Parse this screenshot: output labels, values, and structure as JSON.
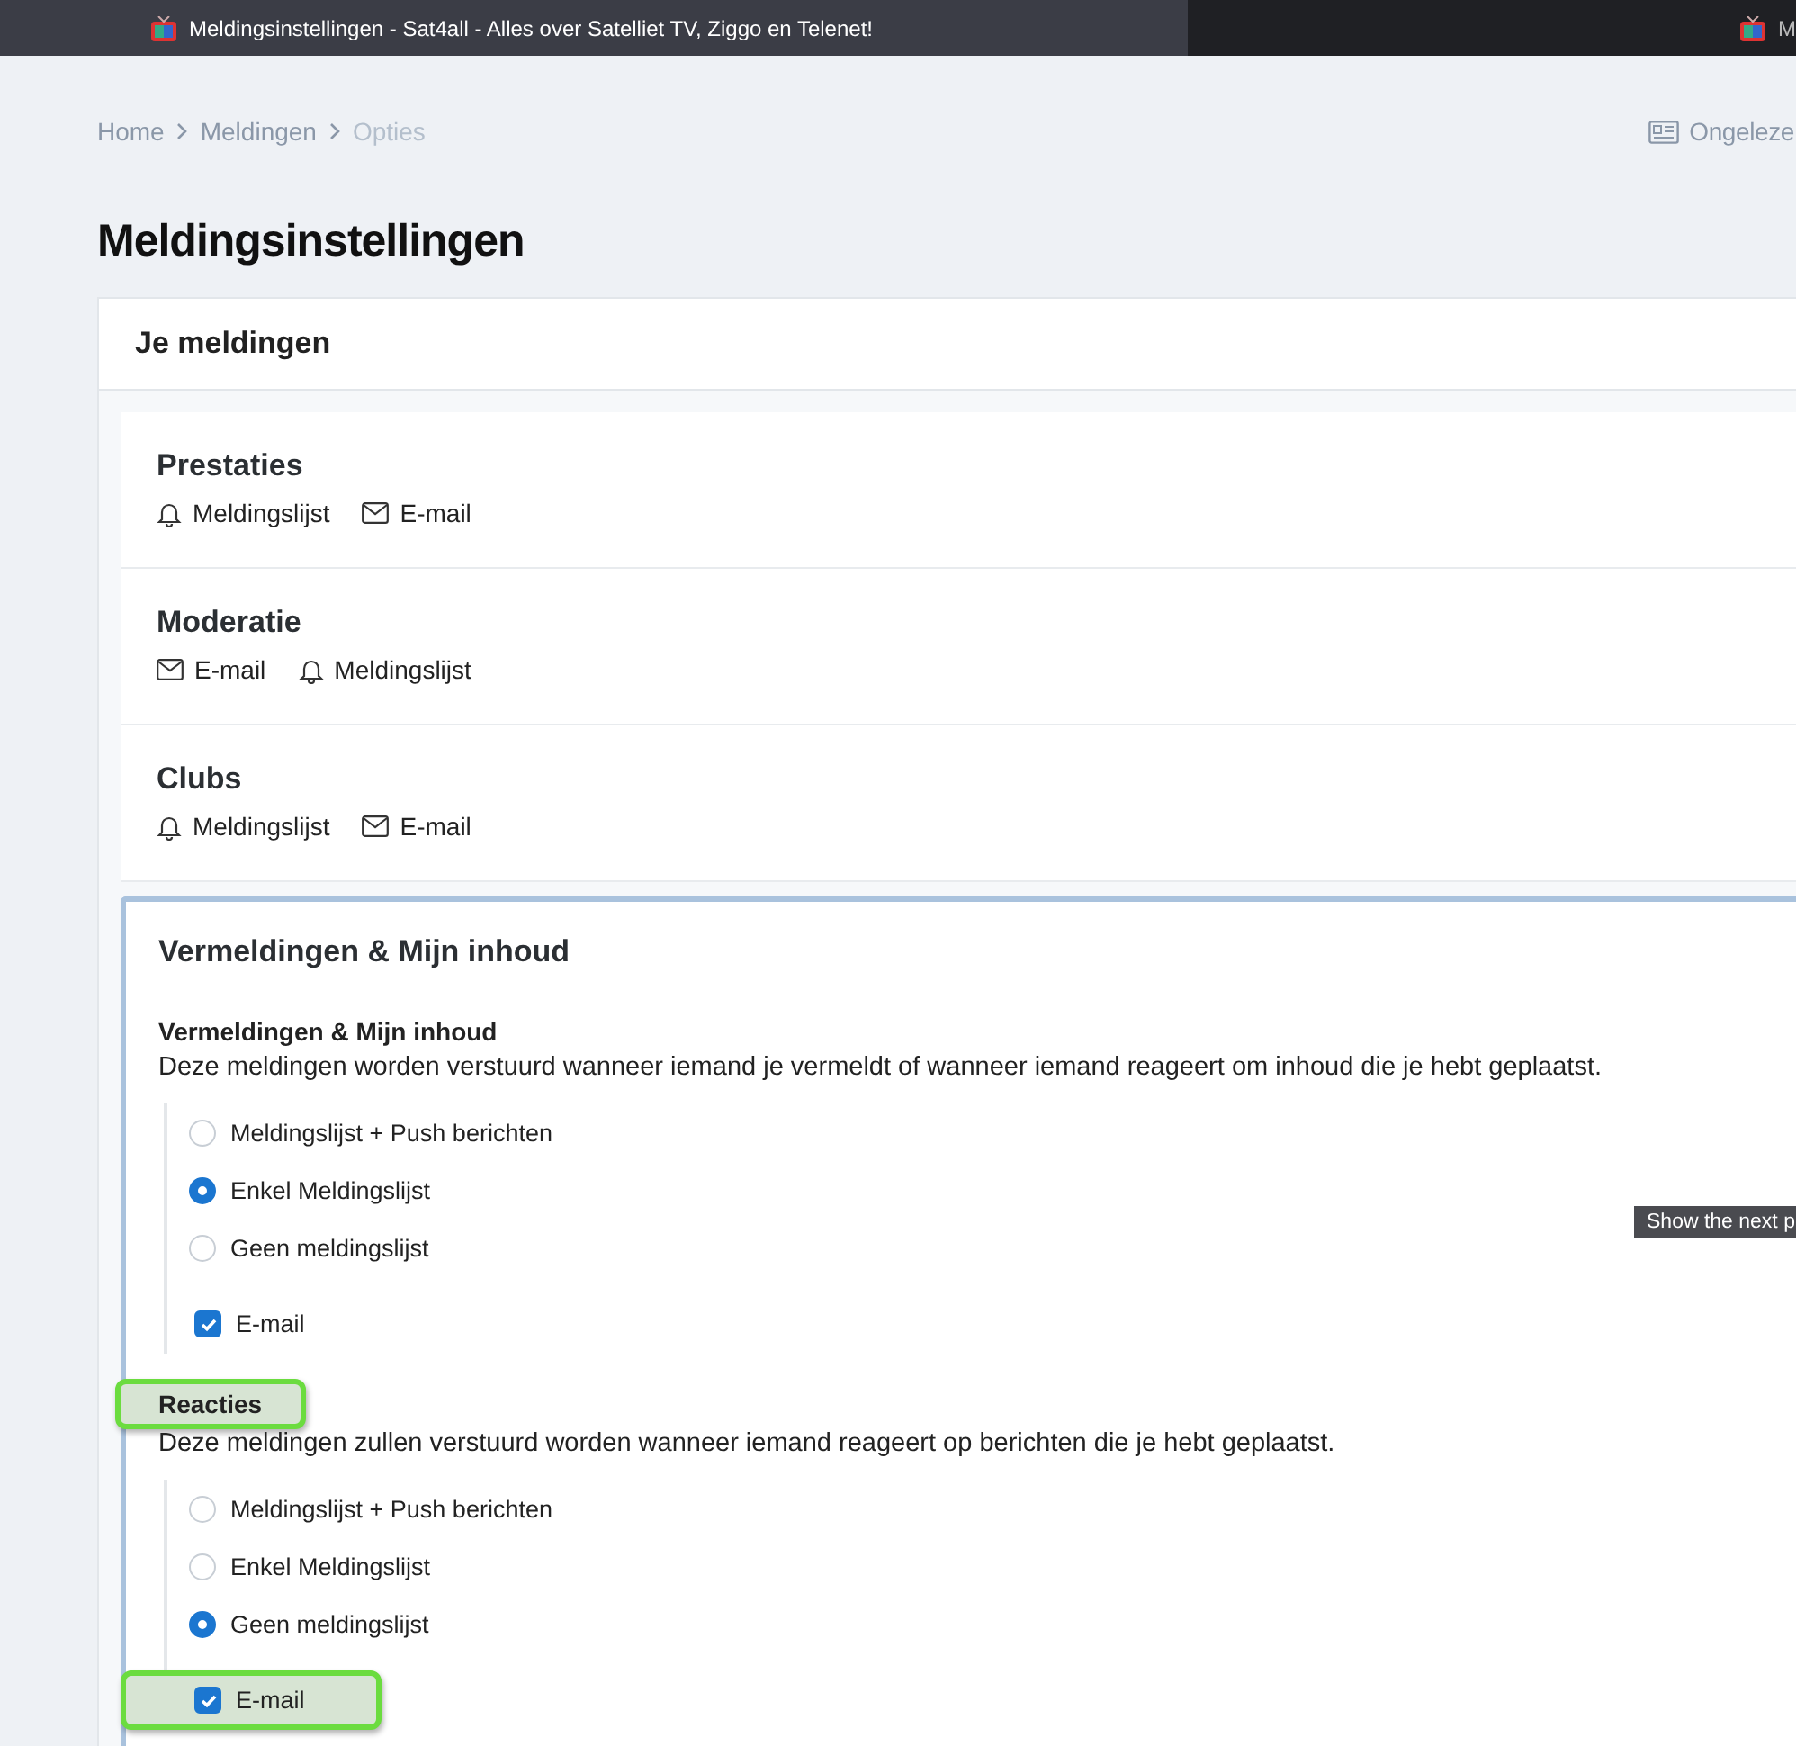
{
  "browser_tabs": [
    {
      "title": "Meldingsinstellingen - Sat4all - Alles over Satelliet TV, Ziggo en Telenet!",
      "selected": true
    },
    {
      "title": "M",
      "selected": false
    }
  ],
  "breadcrumb": [
    {
      "label": "Home",
      "current": false
    },
    {
      "label": "Meldingen",
      "current": false
    },
    {
      "label": "Opties",
      "current": true
    }
  ],
  "unread_link": "Ongeleze",
  "page_title": "Meldingsinstellingen",
  "card_title": "Je meldingen",
  "categories": [
    {
      "title": "Prestaties",
      "channels": [
        {
          "kind": "bell",
          "label": "Meldingslijst"
        },
        {
          "kind": "mail",
          "label": "E-mail"
        }
      ]
    },
    {
      "title": "Moderatie",
      "channels": [
        {
          "kind": "mail",
          "label": "E-mail"
        },
        {
          "kind": "bell",
          "label": "Meldingslijst"
        }
      ]
    },
    {
      "title": "Clubs",
      "channels": [
        {
          "kind": "bell",
          "label": "Meldingslijst"
        },
        {
          "kind": "mail",
          "label": "E-mail"
        }
      ]
    }
  ],
  "expanded_category": {
    "title": "Vermeldingen & Mijn inhoud",
    "groups": [
      {
        "title": "Vermeldingen & Mijn inhoud",
        "highlighted": false,
        "description": "Deze meldingen worden verstuurd wanneer iemand je vermeldt of wanneer iemand reageert om inhoud die je hebt geplaatst.",
        "options": [
          {
            "label": "Meldingslijst + Push berichten",
            "selected": false
          },
          {
            "label": "Enkel Meldingslijst",
            "selected": true
          },
          {
            "label": "Geen meldingslijst",
            "selected": false
          }
        ],
        "email": {
          "label": "E-mail",
          "checked": true,
          "highlighted": false
        }
      },
      {
        "title": "Reacties",
        "highlighted": true,
        "description": "Deze meldingen zullen verstuurd worden wanneer iemand reageert op berichten die je hebt geplaatst.",
        "options": [
          {
            "label": "Meldingslijst + Push berichten",
            "selected": false
          },
          {
            "label": "Enkel Meldingslijst",
            "selected": false
          },
          {
            "label": "Geen meldingslijst",
            "selected": true
          }
        ],
        "email": {
          "label": "E-mail",
          "checked": true,
          "highlighted": true
        }
      }
    ]
  },
  "tooltip": "Show the next p"
}
